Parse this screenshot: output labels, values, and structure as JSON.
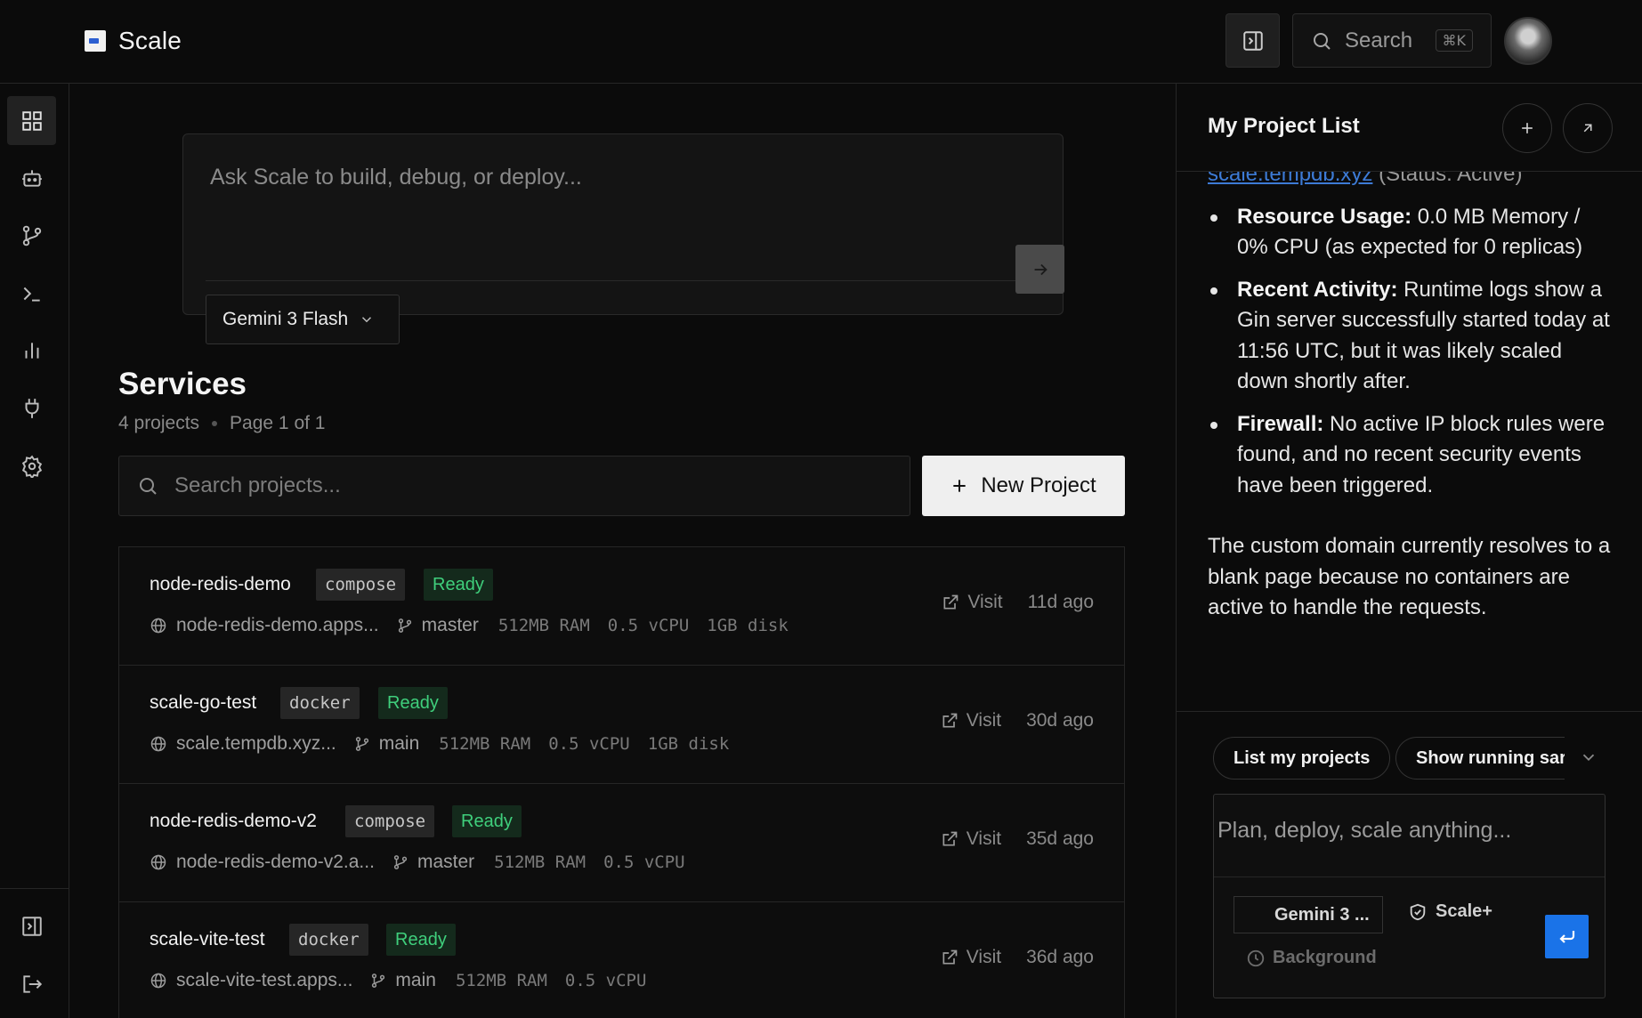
{
  "app": {
    "name": "Scale"
  },
  "header": {
    "search_label": "Search",
    "search_shortcut": "⌘K"
  },
  "rail": {
    "items": [
      "dashboard-icon",
      "bot-icon",
      "git-branch-icon",
      "terminal-icon",
      "bar-chart-icon",
      "plug-icon",
      "gear-icon"
    ],
    "bottom": [
      "panel-icon",
      "logout-icon"
    ]
  },
  "composer": {
    "placeholder": "Ask Scale to build, debug, or deploy...",
    "model": "Gemini 3 Flash"
  },
  "services": {
    "title": "Services",
    "count": "4 projects",
    "page": "Page 1 of 1",
    "search_placeholder": "Search projects...",
    "new_project_label": "New Project",
    "rows": [
      {
        "name": "node-redis-demo",
        "type": "compose",
        "status": "Ready",
        "domain": "node-redis-demo.apps...",
        "branch": "master",
        "ram": "512MB RAM",
        "cpu": "0.5 vCPU",
        "disk": "1GB disk",
        "visit": "Visit",
        "age": "11d ago"
      },
      {
        "name": "scale-go-test",
        "type": "docker",
        "status": "Ready",
        "domain": "scale.tempdb.xyz...",
        "branch": "main",
        "ram": "512MB RAM",
        "cpu": "0.5 vCPU",
        "disk": "1GB disk",
        "visit": "Visit",
        "age": "30d ago"
      },
      {
        "name": "node-redis-demo-v2",
        "type": "compose",
        "status": "Ready",
        "domain": "node-redis-demo-v2.a...",
        "branch": "master",
        "ram": "512MB RAM",
        "cpu": "0.5 vCPU",
        "disk": "",
        "visit": "Visit",
        "age": "35d ago"
      },
      {
        "name": "scale-vite-test",
        "type": "docker",
        "status": "Ready",
        "domain": "scale-vite-test.apps...",
        "branch": "main",
        "ram": "512MB RAM",
        "cpu": "0.5 vCPU",
        "disk": "",
        "visit": "Visit",
        "age": "36d ago"
      }
    ]
  },
  "panel": {
    "title": "My Project List",
    "link_text": "scale.tempdb.xyz",
    "link_status": "(Status: Active)",
    "bullets": [
      {
        "label": "Resource Usage:",
        "text": "0.0 MB Memory / 0% CPU (as expected for 0 replicas)"
      },
      {
        "label": "Recent Activity:",
        "text": "Runtime logs show a Gin server successfully started today at 11:56 UTC, but it was likely scaled down shortly after."
      },
      {
        "label": "Firewall:",
        "text": "No active IP block rules were found, and no recent security events have been triggered."
      }
    ],
    "paragraph": "The custom domain currently resolves to a blank page because no containers are active to handle the requests.",
    "chips": [
      "List my projects",
      "Show running sar"
    ],
    "chat_placeholder": "Plan, deploy, scale anything...",
    "chat_model": "Gemini 3 ...",
    "chat_mode": "Scale+",
    "chat_background": "Background"
  },
  "colors": {
    "accent": "#1a73e8",
    "ready": "#3fcf7c",
    "link": "#3d7bd6"
  }
}
